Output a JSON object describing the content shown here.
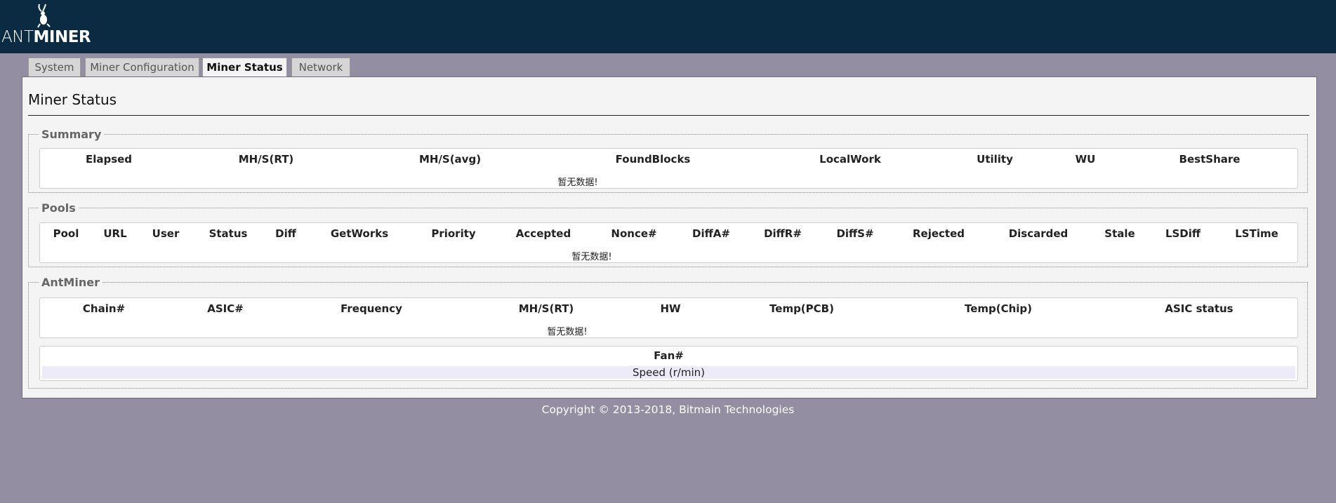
{
  "header": {
    "logo_ant": "ANT",
    "logo_miner": "MINER",
    "logo_icon": "ant-icon",
    "background": "#0b2b42"
  },
  "tabs": [
    {
      "label": "System",
      "active": false
    },
    {
      "label": "Miner Configuration",
      "active": false
    },
    {
      "label": "Miner Status",
      "active": true
    },
    {
      "label": "Network",
      "active": false
    }
  ],
  "page": {
    "title": "Miner Status"
  },
  "summary": {
    "legend": "Summary",
    "columns": [
      "Elapsed",
      "MH/S(RT)",
      "MH/S(avg)",
      "FoundBlocks",
      "LocalWork",
      "Utility",
      "WU",
      "BestShare"
    ],
    "empty_text": "暂无数据!"
  },
  "pools": {
    "legend": "Pools",
    "columns": [
      "Pool",
      "URL",
      "User",
      "Status",
      "Diff",
      "GetWorks",
      "Priority",
      "Accepted",
      "Nonce#",
      "DiffA#",
      "DiffR#",
      "DiffS#",
      "Rejected",
      "Discarded",
      "Stale",
      "LSDiff",
      "LSTime"
    ],
    "empty_text": "暂无数据!"
  },
  "antminer": {
    "legend": "AntMiner",
    "columns": [
      "Chain#",
      "ASIC#",
      "Frequency",
      "MH/S(RT)",
      "HW",
      "Temp(PCB)",
      "Temp(Chip)",
      "ASIC status"
    ],
    "empty_text": "暂无数据!",
    "fan": {
      "header": "Fan#",
      "row_label": "Speed (r/min)"
    }
  },
  "footer": {
    "copyright": "Copyright © 2013-2018, Bitmain Technologies"
  },
  "colors": {
    "page_background": "#938ea2",
    "header_background": "#0b2b42",
    "panel_background": "#f4f4f4",
    "fan_row_background": "#ecebf7"
  }
}
